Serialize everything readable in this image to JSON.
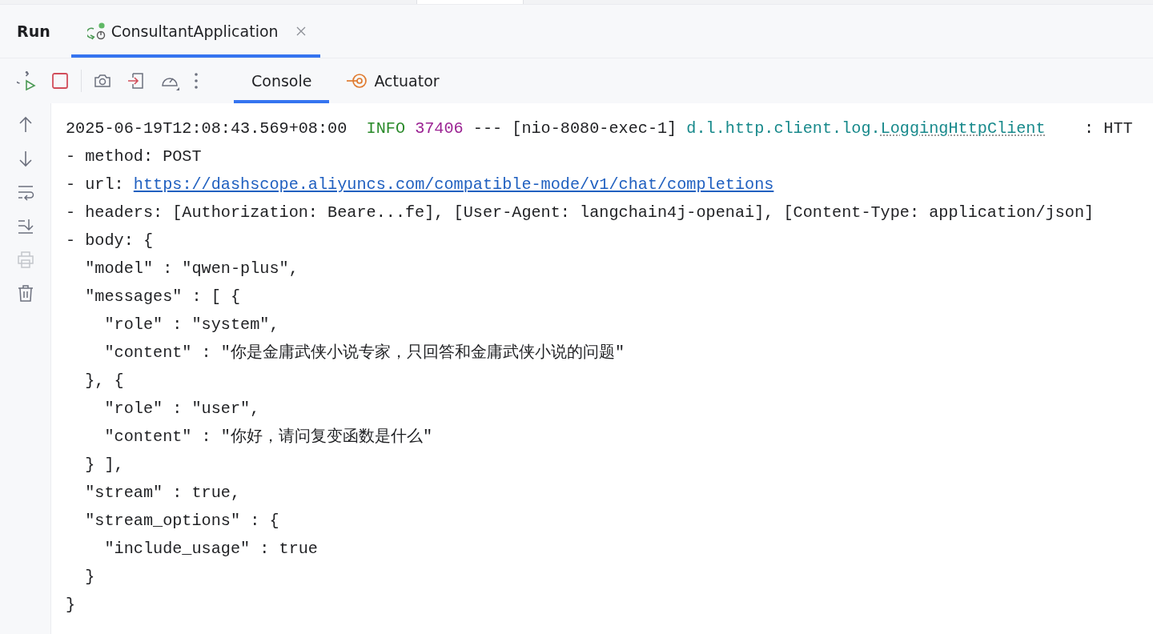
{
  "tool_window": {
    "title": "Run",
    "tabs": [
      {
        "label": "ConsultantApplication",
        "selected": true
      }
    ]
  },
  "toolbar": {
    "actions": [
      {
        "kind": "rerun",
        "disabled": false
      },
      {
        "kind": "stop",
        "disabled": false
      },
      {
        "kind": "camera",
        "disabled": false
      },
      {
        "kind": "enter",
        "disabled": false
      },
      {
        "kind": "gauge",
        "disabled": false
      },
      {
        "kind": "more",
        "disabled": false
      }
    ],
    "tabs": [
      {
        "label": "Console",
        "kind": "console",
        "selected": true
      },
      {
        "label": "Actuator",
        "kind": "actuator",
        "selected": false
      }
    ]
  },
  "gutter": {
    "actions": [
      {
        "kind": "up",
        "disabled": false
      },
      {
        "kind": "down",
        "disabled": false
      },
      {
        "kind": "wrap",
        "disabled": false
      },
      {
        "kind": "scroll-end",
        "disabled": false
      },
      {
        "kind": "print",
        "disabled": true
      },
      {
        "kind": "trash",
        "disabled": false
      }
    ]
  },
  "console": {
    "lines": [
      {
        "segments": [
          {
            "kind": "plain",
            "text": "2025-06-19T12:08:43.569+08:00"
          },
          {
            "kind": "level",
            "text": "  INFO"
          },
          {
            "kind": "pid",
            "text": " 37406"
          },
          {
            "kind": "plain",
            "text": " --- [nio-8080-exec-1]"
          },
          {
            "kind": "logger",
            "text": " d.l.http.client.log."
          },
          {
            "kind": "logger-class",
            "text": "LoggingHttpClient"
          },
          {
            "kind": "plain",
            "text": "    : HTT"
          }
        ]
      },
      {
        "segments": [
          {
            "kind": "plain",
            "text": "- method: POST"
          }
        ]
      },
      {
        "segments": [
          {
            "kind": "plain",
            "text": "- url: "
          },
          {
            "kind": "link",
            "text": "https://dashscope.aliyuncs.com/compatible-mode/v1/chat/completions"
          }
        ]
      },
      {
        "segments": [
          {
            "kind": "plain",
            "text": "- headers: [Authorization: Beare...fe], [User-Agent: langchain4j-openai], [Content-Type: application/json]"
          }
        ]
      },
      {
        "segments": [
          {
            "kind": "plain",
            "text": "- body: {"
          }
        ]
      },
      {
        "segments": [
          {
            "kind": "plain",
            "text": "  \"model\" : \"qwen-plus\","
          }
        ]
      },
      {
        "segments": [
          {
            "kind": "plain",
            "text": "  \"messages\" : [ {"
          }
        ]
      },
      {
        "segments": [
          {
            "kind": "plain",
            "text": "    \"role\" : \"system\","
          }
        ]
      },
      {
        "segments": [
          {
            "kind": "plain",
            "text": "    \"content\" : \"你是金庸武侠小说专家，只回答和金庸武侠小说的问题\""
          }
        ]
      },
      {
        "segments": [
          {
            "kind": "plain",
            "text": "  }, {"
          }
        ]
      },
      {
        "segments": [
          {
            "kind": "plain",
            "text": "    \"role\" : \"user\","
          }
        ]
      },
      {
        "segments": [
          {
            "kind": "plain",
            "text": "    \"content\" : \"你好，请问复变函数是什么\""
          }
        ]
      },
      {
        "segments": [
          {
            "kind": "plain",
            "text": "  } ],"
          }
        ]
      },
      {
        "segments": [
          {
            "kind": "plain",
            "text": "  \"stream\" : true,"
          }
        ]
      },
      {
        "segments": [
          {
            "kind": "plain",
            "text": "  \"stream_options\" : {"
          }
        ]
      },
      {
        "segments": [
          {
            "kind": "plain",
            "text": "    \"include_usage\" : true"
          }
        ]
      },
      {
        "segments": [
          {
            "kind": "plain",
            "text": "  }"
          }
        ]
      },
      {
        "segments": [
          {
            "kind": "plain",
            "text": "}"
          }
        ]
      }
    ]
  }
}
